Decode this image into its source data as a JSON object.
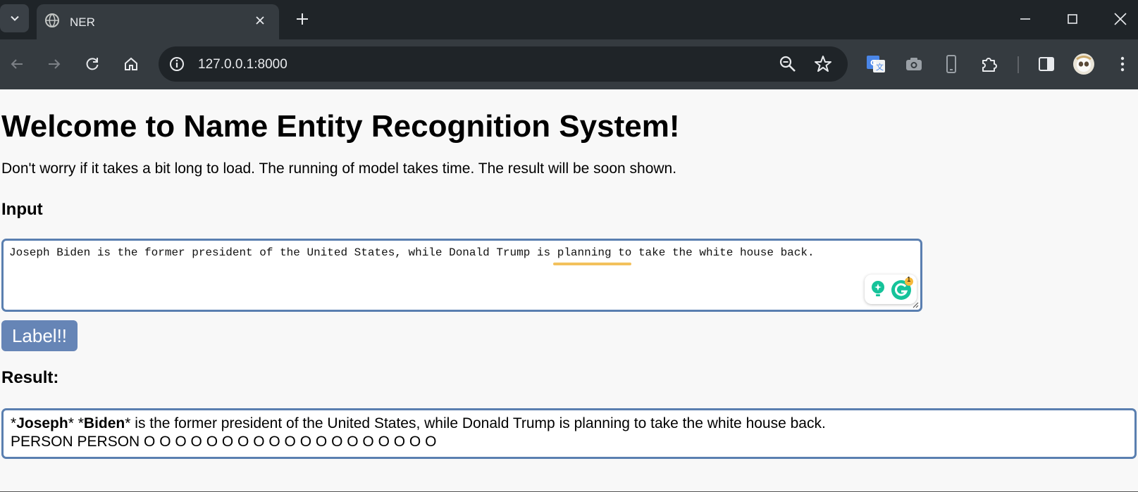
{
  "browser": {
    "tab_title": "NER",
    "url": "127.0.0.1:8000"
  },
  "page": {
    "heading": "Welcome to Name Entity Recognition System!",
    "lead": "Don't worry if it takes a bit long to load. The running of model takes time. The result will be soon shown.",
    "input_heading": "Input",
    "input_value": "Joseph Biden is the former president of the United States, while Donald Trump is planning to take the white house back.",
    "button_label": "Label!!",
    "result_heading": "Result:",
    "result": {
      "entity1": "Joseph",
      "entity2": "Biden",
      "rest": " is the former president of the United States, while Donald Trump is planning to take the white house back.",
      "labels": "PERSON PERSON O O O O O O O O O O O O O O O O O O O"
    },
    "grammarly_badge": "1"
  },
  "colors": {
    "accent": "#5a7fb0",
    "button": "#6685b6",
    "tabstrip": "#1f2428",
    "toolbar": "#353b40"
  }
}
